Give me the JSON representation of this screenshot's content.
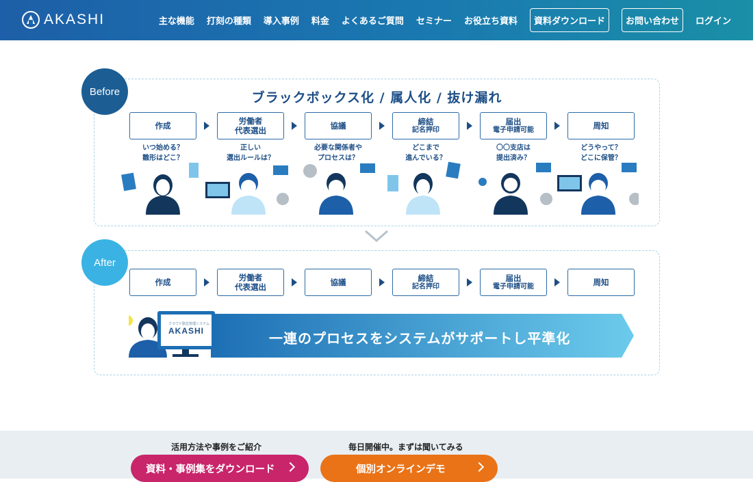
{
  "header": {
    "logo_text": "AKASHI",
    "nav_items": [
      "主な機能",
      "打刻の種類",
      "導入事例",
      "料金",
      "よくあるご質問",
      "セミナー",
      "お役立ち資料"
    ],
    "nav_buttons": [
      "資料ダウンロード",
      "お問い合わせ"
    ],
    "login": "ログイン"
  },
  "before": {
    "badge": "Before",
    "title": "ブラックボックス化 / 属人化 / 抜け漏れ",
    "steps": [
      {
        "label": "作成",
        "sub": ""
      },
      {
        "label": "労働者",
        "sub": "代表選出"
      },
      {
        "label": "協議",
        "sub": ""
      },
      {
        "label": "締結",
        "sub": "記名押印"
      },
      {
        "label": "届出",
        "sub": "電子申請可能"
      },
      {
        "label": "周知",
        "sub": ""
      }
    ],
    "questions": [
      "いつ始める？\n雛形はどこ？",
      "正しい\n選出ルールは？",
      "必要な関係者や\nプロセスは？",
      "どこまで\n進んでいる？",
      "〇〇支店は\n提出済み？",
      "どうやって？\nどこに保管？"
    ]
  },
  "after": {
    "badge": "After",
    "steps": [
      {
        "label": "作成",
        "sub": ""
      },
      {
        "label": "労働者",
        "sub": "代表選出"
      },
      {
        "label": "協議",
        "sub": ""
      },
      {
        "label": "締結",
        "sub": "記名押印"
      },
      {
        "label": "届出",
        "sub": "電子申請可能"
      },
      {
        "label": "周知",
        "sub": ""
      }
    ],
    "screen_caption": "クラウド勤怠管理システム",
    "screen_logo": "AKASHI",
    "banner_text": "一連のプロセスをシステムがサポートし平準化"
  },
  "cta": {
    "caption_1": "活用方法や事例をご紹介",
    "caption_2": "毎日開催中。まずは聞いてみる",
    "button_1": "資料・事例集をダウンロード",
    "button_2": "個別オンラインデモ"
  },
  "colors": {
    "brand_blue": "#1c5d94",
    "light_blue": "#3ab3e4",
    "cta_pink": "#c8256b",
    "cta_orange": "#ea7317"
  }
}
